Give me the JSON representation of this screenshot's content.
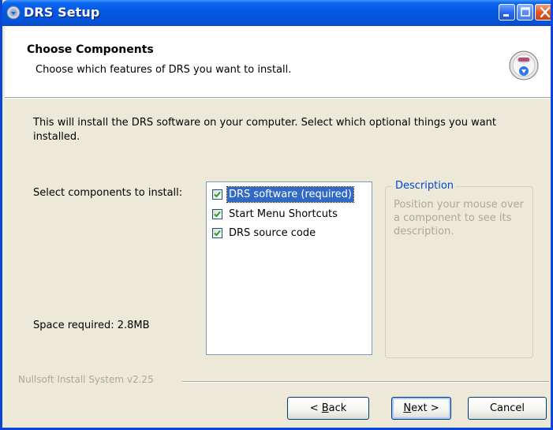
{
  "window": {
    "title": "DRS Setup"
  },
  "header": {
    "title": "Choose Components",
    "subtitle": "Choose which features of DRS you want to install."
  },
  "main": {
    "intro": "This will install the DRS software on your computer. Select which optional things you want installed.",
    "select_label": "Select components to install:",
    "space_required": "Space required: 2.8MB",
    "components": [
      {
        "label": "DRS software (required)",
        "checked": true,
        "selected": true
      },
      {
        "label": "Start Menu Shortcuts",
        "checked": true,
        "selected": false
      },
      {
        "label": "DRS source code",
        "checked": true,
        "selected": false
      }
    ],
    "description": {
      "legend": "Description",
      "text": "Position your mouse over a component to see its description."
    }
  },
  "footer": {
    "branding": "Nullsoft Install System v2.25",
    "back": {
      "prefix": "< ",
      "accel": "B",
      "rest": "ack"
    },
    "next": {
      "accel": "N",
      "rest": "ext >"
    },
    "cancel": "Cancel"
  },
  "colors": {
    "titlebar": "#0458e0",
    "dialog_bg": "#ece9d8",
    "selection": "#316ac5",
    "group_legend": "#0046d5",
    "disabled_text": "#aca899"
  }
}
